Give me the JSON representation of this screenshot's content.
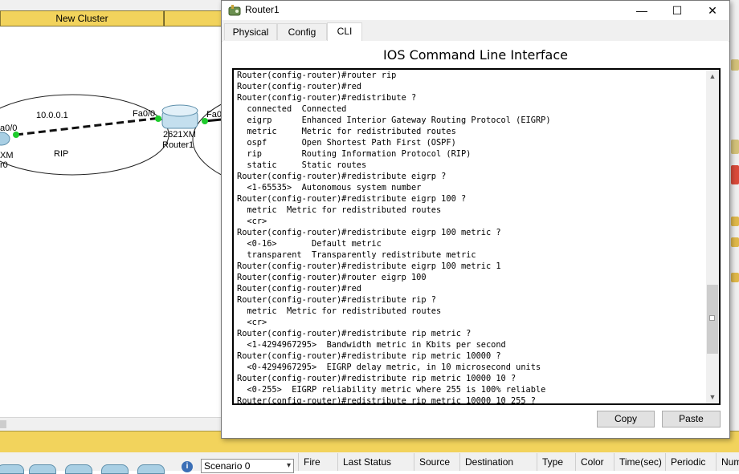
{
  "background": {
    "cluster_tab": "New Cluster",
    "workspace": {
      "network_label": "10.0.0.1",
      "interface_left_router": "Fa0/0",
      "interface_router1_left": "Fa0/0",
      "interface_router1_right": "Fa0",
      "partial_label_left_1": "a0/0",
      "partial_label_left_2": "XM",
      "partial_label_left_3": "r0",
      "area_label": "RIP",
      "router_model": "2621XM",
      "router_name": "Router1"
    },
    "scenario": {
      "selected": "Scenario 0"
    },
    "pdu_columns": [
      "Fire",
      "Last Status",
      "Source",
      "Destination",
      "Type",
      "Color",
      "Time(sec)",
      "Periodic",
      "Num"
    ]
  },
  "window": {
    "title": "Router1",
    "controls": {
      "minimize": "—",
      "maximize": "☐",
      "close": "✕"
    },
    "tabs": [
      {
        "label": "Physical",
        "active": false
      },
      {
        "label": "Config",
        "active": false
      },
      {
        "label": "CLI",
        "active": true
      }
    ],
    "cli": {
      "heading": "IOS Command Line Interface",
      "output": "Router(config-router)#router rip\nRouter(config-router)#red\nRouter(config-router)#redistribute ?\n  connected  Connected\n  eigrp      Enhanced Interior Gateway Routing Protocol (EIGRP)\n  metric     Metric for redistributed routes\n  ospf       Open Shortest Path First (OSPF)\n  rip        Routing Information Protocol (RIP)\n  static     Static routes\nRouter(config-router)#redistribute eigrp ?\n  <1-65535>  Autonomous system number\nRouter(config-router)#redistribute eigrp 100 ?\n  metric  Metric for redistributed routes\n  <cr>\nRouter(config-router)#redistribute eigrp 100 metric ?\n  <0-16>       Default metric\n  transparent  Transparently redistribute metric\nRouter(config-router)#redistribute eigrp 100 metric 1\nRouter(config-router)#router eigrp 100\nRouter(config-router)#red\nRouter(config-router)#redistribute rip ?\n  metric  Metric for redistributed routes\n  <cr>\nRouter(config-router)#redistribute rip metric ?\n  <1-4294967295>  Bandwidth metric in Kbits per second\nRouter(config-router)#redistribute rip metric 10000 ?\n  <0-4294967295>  EIGRP delay metric, in 10 microsecond units\nRouter(config-router)#redistribute rip metric 10000 10 ?\n  <0-255>  EIGRP reliability metric where 255 is 100% reliable\nRouter(config-router)#redistribute rip metric 10000 10 255 ?",
      "copy_button": "Copy",
      "paste_button": "Paste"
    }
  },
  "colors": {
    "cluster_bar": "#f2d35c",
    "link_green": "#1ecb2c",
    "router_blue": "#a9cfe4"
  },
  "icons": [
    "router-icon",
    "info-icon",
    "scroll-up-icon",
    "scroll-down-icon"
  ]
}
